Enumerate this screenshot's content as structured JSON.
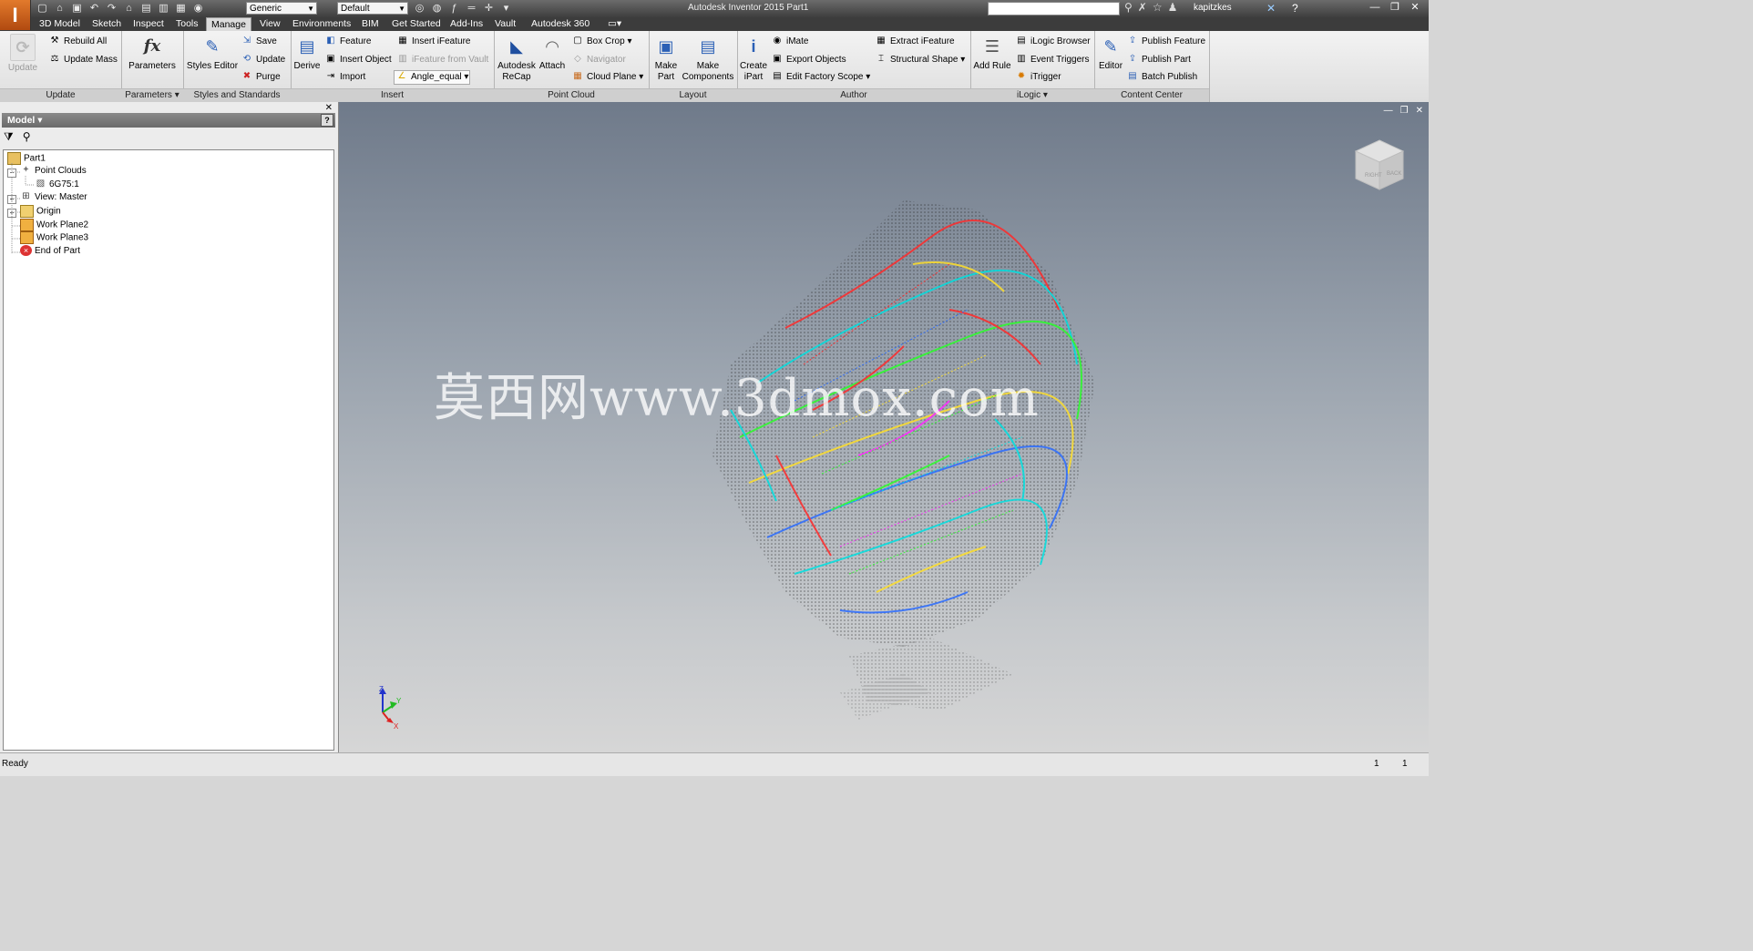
{
  "titlebar": {
    "style_combo": "Generic",
    "appearance_combo": "Default",
    "title": "Autodesk Inventor 2015    Part1",
    "user": "kapitzkes"
  },
  "menu_tabs": [
    "3D Model",
    "Sketch",
    "Inspect",
    "Tools",
    "Manage",
    "View",
    "Environments",
    "BIM",
    "Get Started",
    "Add-Ins",
    "Vault",
    "Autodesk 360"
  ],
  "active_tab": "Manage",
  "ribbon": {
    "update": {
      "title": "Update",
      "update_label": "Update",
      "rebuild_all": "Rebuild All",
      "update_mass": "Update Mass"
    },
    "parameters": {
      "title": "Parameters",
      "parameters_label": "Parameters"
    },
    "styles": {
      "title": "Styles and Standards",
      "styles_editor": "Styles Editor",
      "save": "Save",
      "update": "Update",
      "purge": "Purge"
    },
    "insert": {
      "title": "Insert",
      "derive": "Derive",
      "feature": "Feature",
      "insert_object": "Insert Object",
      "import": "Import",
      "insert_ifeature": "Insert iFeature",
      "ifeature_from_vault": "iFeature from Vault",
      "angle_equal": "Angle_equal"
    },
    "point_cloud": {
      "title": "Point Cloud",
      "recap_1": "Autodesk",
      "recap_2": "ReCap",
      "attach": "Attach",
      "box_crop": "Box Crop",
      "navigator": "Navigator",
      "cloud_plane": "Cloud Plane"
    },
    "layout": {
      "title": "Layout",
      "make_part_1": "Make",
      "make_part_2": "Part",
      "make_components_1": "Make",
      "make_components_2": "Components"
    },
    "author": {
      "title": "Author",
      "create_ipart_1": "Create",
      "create_ipart_2": "iPart",
      "imate": "iMate",
      "export_objects": "Export Objects",
      "edit_factory_scope": "Edit Factory Scope",
      "extract_ifeature": "Extract iFeature",
      "structural_shape": "Structural Shape"
    },
    "ilogic": {
      "title": "iLogic",
      "add_rule": "Add Rule",
      "ilogic_browser": "iLogic Browser",
      "event_triggers": "Event Triggers",
      "itrigger": "iTrigger"
    },
    "content_center": {
      "title": "Content Center",
      "editor": "Editor",
      "publish_feature": "Publish Feature",
      "publish_part": "Publish Part",
      "batch_publish": "Batch Publish"
    }
  },
  "browser": {
    "header": "Model",
    "help": "?",
    "tree": {
      "root": "Part1",
      "point_clouds": "Point Clouds",
      "cloud_item": "6G75:1",
      "view": "View: Master",
      "origin": "Origin",
      "work_plane2": "Work Plane2",
      "work_plane3": "Work Plane3",
      "end_of_part": "End of Part"
    }
  },
  "viewport": {
    "watermark": "莫西网www.3dmox.com",
    "viewcube_faces": [
      "RIGHT",
      "BACK"
    ],
    "triad_axes": [
      "Z",
      "Y",
      "X"
    ]
  },
  "status": {
    "text": "Ready",
    "count1": "1",
    "count2": "1"
  },
  "colors": {
    "app_orange": "#c85a17",
    "viewport_top": "#6f7a8a",
    "viewport_bottom": "#d6d6d6"
  }
}
